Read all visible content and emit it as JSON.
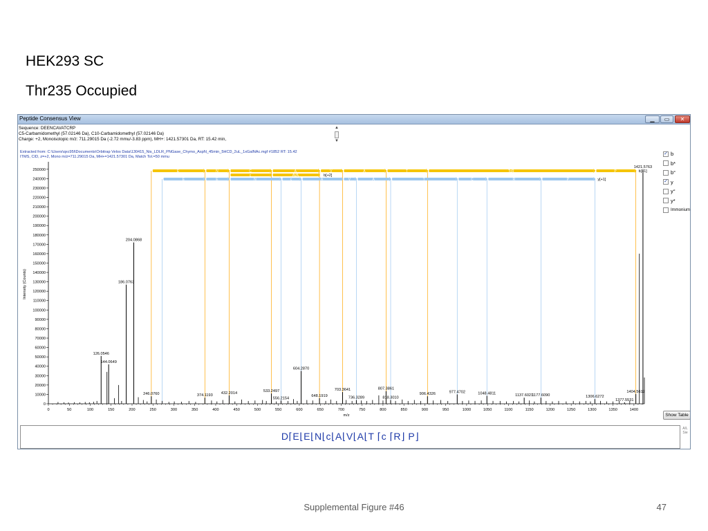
{
  "slide": {
    "title_line1": "HEK293 SC",
    "title_line2": "Thr235 Occupied",
    "footer_caption": "Supplemental Figure #46",
    "page_number": "47"
  },
  "window": {
    "title": "Peptide Consensus View",
    "min_icon": "minimize-icon",
    "max_icon": "maximize-icon",
    "close_icon": "close-icon",
    "min_glyph": "▁",
    "max_glyph": "▭",
    "close_glyph": "✕"
  },
  "info": {
    "line1": "Sequence: DEENCAVATCRP",
    "line2": "C5-Carbamidomethyl (57.02146 Da), C10-Carbamidomethyl (57.02146 Da)",
    "line3": "Charge: +2,   Monoisotopic m/z: 711.29015 Da (-2.72 mmu/-3.83 ppm),   MH+: 1421.57301 Da,   RT: 15.42 min,",
    "scroll_up": "▲",
    "scroll_down": "▼"
  },
  "spectrum_header": {
    "line1": "Extracted from: C:\\Users\\qxc95l\\Documents\\Orbitrap Velos Data\\130415_Nis_LDLR_PNGase_Chymo_AspN_45min_5HCD_2uL_1xGalNAc.mgf   #1852   RT: 15.42",
    "line2": "ITMS, CID, z=+2, Mono m/z=711.29015 Da, MH+=1421.57301 Da, Match Tol.=50 mmu"
  },
  "legend": {
    "items": [
      {
        "label": "b",
        "checked": true
      },
      {
        "label": "b*",
        "checked": false
      },
      {
        "label": "b°",
        "checked": false
      },
      {
        "label": "y",
        "checked": true
      },
      {
        "label": "y°",
        "checked": false
      },
      {
        "label": "y*",
        "checked": false
      },
      {
        "label": "Immonium",
        "checked": false
      }
    ],
    "check_glyph": "✓"
  },
  "show_table_label": "Show Table",
  "sequence_display": "D⌈E⌊E⌊N⌊c⌊A⌊V⌊A⌊T ⌈c ⌈R⌋ P⌋",
  "sequence_scroll": [
    "A/L",
    "Sie"
  ],
  "colors": {
    "b_ion": "#f5c400",
    "y_ion": "#9ac6ef",
    "matched_b": "#ffa500",
    "matched_y": "#5b9bd5",
    "peak": "#000000",
    "link": "#1e3aa8"
  },
  "chart_data": {
    "type": "bar",
    "xlabel": "m/z",
    "ylabel": "Intensity (Counts)",
    "xlim": [
      0,
      1425
    ],
    "ylim": [
      0,
      255000
    ],
    "xticks": [
      0,
      50,
      100,
      150,
      200,
      250,
      300,
      350,
      400,
      450,
      500,
      550,
      600,
      650,
      700,
      750,
      800,
      850,
      900,
      950,
      1000,
      1050,
      1100,
      1150,
      1200,
      1250,
      1300,
      1350,
      1400
    ],
    "yticks": [
      0,
      10000,
      20000,
      30000,
      40000,
      50000,
      60000,
      70000,
      80000,
      90000,
      100000,
      110000,
      120000,
      130000,
      140000,
      150000,
      160000,
      170000,
      180000,
      190000,
      200000,
      210000,
      220000,
      230000,
      240000,
      250000
    ],
    "labeled_peaks": [
      {
        "mz": 126.0546,
        "intensity": 51000,
        "label": "126.0546"
      },
      {
        "mz": 144.0649,
        "intensity": 42000,
        "label": "144.0649"
      },
      {
        "mz": 186.0763,
        "intensity": 127000,
        "label": "186.0763"
      },
      {
        "mz": 204.0868,
        "intensity": 172000,
        "label": "204.0868"
      },
      {
        "mz": 246.076,
        "intensity": 8000,
        "label": "246.0760"
      },
      {
        "mz": 374.1193,
        "intensity": 6500,
        "label": "374.1193"
      },
      {
        "mz": 432.2014,
        "intensity": 9000,
        "label": "432.2014"
      },
      {
        "mz": 533.2497,
        "intensity": 11000,
        "label": "533.2497"
      },
      {
        "mz": 556.2154,
        "intensity": 3500,
        "label": "556.2154"
      },
      {
        "mz": 604.287,
        "intensity": 35000,
        "label": "604.2870"
      },
      {
        "mz": 648.1919,
        "intensity": 6000,
        "label": "648.1919"
      },
      {
        "mz": 703.3641,
        "intensity": 12500,
        "label": "703.3641"
      },
      {
        "mz": 736.3289,
        "intensity": 4000,
        "label": "736.3289"
      },
      {
        "mz": 807.3861,
        "intensity": 13500,
        "label": "807.3861"
      },
      {
        "mz": 818.301,
        "intensity": 4000,
        "label": "818.3010"
      },
      {
        "mz": 906.4326,
        "intensity": 8000,
        "label": "906.4326"
      },
      {
        "mz": 977.4702,
        "intensity": 10000,
        "label": "977.4702"
      },
      {
        "mz": 1048.4811,
        "intensity": 8500,
        "label": "1048.4811"
      },
      {
        "mz": 1137.6021,
        "intensity": 6500,
        "label": "1137.6021"
      },
      {
        "mz": 1177.609,
        "intensity": 6500,
        "label": "1177.6090"
      },
      {
        "mz": 1306.6272,
        "intensity": 5000,
        "label": "1306.6272"
      },
      {
        "mz": 1377.5531,
        "intensity": 1500,
        "label": "1377.5531"
      },
      {
        "mz": 1404.5612,
        "intensity": 10500,
        "label": "1404.5612"
      },
      {
        "mz": 1421.5763,
        "intensity": 250000,
        "label": "1421.5763"
      }
    ],
    "unlabeled_peaks": [
      {
        "mz": 23,
        "intensity": 1800
      },
      {
        "mz": 37,
        "intensity": 1600
      },
      {
        "mz": 48,
        "intensity": 1400
      },
      {
        "mz": 62,
        "intensity": 1700
      },
      {
        "mz": 75,
        "intensity": 1500
      },
      {
        "mz": 88,
        "intensity": 1900
      },
      {
        "mz": 98,
        "intensity": 1600
      },
      {
        "mz": 108,
        "intensity": 2200
      },
      {
        "mz": 116,
        "intensity": 3000
      },
      {
        "mz": 140,
        "intensity": 34000
      },
      {
        "mz": 158,
        "intensity": 6000
      },
      {
        "mz": 168,
        "intensity": 20000
      },
      {
        "mz": 175,
        "intensity": 3000
      },
      {
        "mz": 215,
        "intensity": 7000
      },
      {
        "mz": 227,
        "intensity": 4000
      },
      {
        "mz": 236,
        "intensity": 2500
      },
      {
        "mz": 258,
        "intensity": 4500
      },
      {
        "mz": 272,
        "intensity": 3000
      },
      {
        "mz": 288,
        "intensity": 2000
      },
      {
        "mz": 301,
        "intensity": 2500
      },
      {
        "mz": 318,
        "intensity": 2200
      },
      {
        "mz": 336,
        "intensity": 3000
      },
      {
        "mz": 352,
        "intensity": 2000
      },
      {
        "mz": 390,
        "intensity": 3500
      },
      {
        "mz": 403,
        "intensity": 2500
      },
      {
        "mz": 417,
        "intensity": 4000
      },
      {
        "mz": 446,
        "intensity": 2500
      },
      {
        "mz": 462,
        "intensity": 4500
      },
      {
        "mz": 478,
        "intensity": 3000
      },
      {
        "mz": 494,
        "intensity": 3500
      },
      {
        "mz": 512,
        "intensity": 4000
      },
      {
        "mz": 521,
        "intensity": 3000
      },
      {
        "mz": 545,
        "intensity": 2500
      },
      {
        "mz": 573,
        "intensity": 3000
      },
      {
        "mz": 586,
        "intensity": 5000
      },
      {
        "mz": 595,
        "intensity": 3000
      },
      {
        "mz": 618,
        "intensity": 4000
      },
      {
        "mz": 632,
        "intensity": 3500
      },
      {
        "mz": 663,
        "intensity": 3000
      },
      {
        "mz": 675,
        "intensity": 4500
      },
      {
        "mz": 689,
        "intensity": 3000
      },
      {
        "mz": 712,
        "intensity": 4000
      },
      {
        "mz": 726,
        "intensity": 3000
      },
      {
        "mz": 748,
        "intensity": 3500
      },
      {
        "mz": 761,
        "intensity": 3000
      },
      {
        "mz": 775,
        "intensity": 4000
      },
      {
        "mz": 790,
        "intensity": 9000
      },
      {
        "mz": 800,
        "intensity": 3500
      },
      {
        "mz": 830,
        "intensity": 3000
      },
      {
        "mz": 846,
        "intensity": 4500
      },
      {
        "mz": 860,
        "intensity": 3000
      },
      {
        "mz": 875,
        "intensity": 4000
      },
      {
        "mz": 890,
        "intensity": 3000
      },
      {
        "mz": 920,
        "intensity": 3500
      },
      {
        "mz": 938,
        "intensity": 4000
      },
      {
        "mz": 955,
        "intensity": 3000
      },
      {
        "mz": 990,
        "intensity": 3000
      },
      {
        "mz": 1005,
        "intensity": 3500
      },
      {
        "mz": 1020,
        "intensity": 3000
      },
      {
        "mz": 1035,
        "intensity": 3500
      },
      {
        "mz": 1063,
        "intensity": 3000
      },
      {
        "mz": 1080,
        "intensity": 3000
      },
      {
        "mz": 1095,
        "intensity": 2500
      },
      {
        "mz": 1112,
        "intensity": 3000
      },
      {
        "mz": 1125,
        "intensity": 2500
      },
      {
        "mz": 1150,
        "intensity": 3500
      },
      {
        "mz": 1162,
        "intensity": 2500
      },
      {
        "mz": 1190,
        "intensity": 3000
      },
      {
        "mz": 1205,
        "intensity": 2500
      },
      {
        "mz": 1220,
        "intensity": 3000
      },
      {
        "mz": 1238,
        "intensity": 2500
      },
      {
        "mz": 1255,
        "intensity": 3000
      },
      {
        "mz": 1270,
        "intensity": 2500
      },
      {
        "mz": 1285,
        "intensity": 3000
      },
      {
        "mz": 1296,
        "intensity": 2500
      },
      {
        "mz": 1320,
        "intensity": 3000
      },
      {
        "mz": 1335,
        "intensity": 2500
      },
      {
        "mz": 1350,
        "intensity": 2500
      },
      {
        "mz": 1365,
        "intensity": 3000
      },
      {
        "mz": 1390,
        "intensity": 3000
      },
      {
        "mz": 1413,
        "intensity": 160000
      },
      {
        "mz": 1425,
        "intensity": 28000
      }
    ],
    "b_ions": {
      "series_label": "b[+1]",
      "matched_mz": [
        246.076,
        374.1193,
        432.2014,
        533.2497,
        648.1919,
        703.3641,
        807.3861,
        906.4326,
        1404.5612
      ],
      "segments": [
        {
          "from": 246.076,
          "to": 374.1193,
          "residue": "E"
        },
        {
          "from": 374.1193,
          "to": 432.2014,
          "residue": "N"
        },
        {
          "from": 432.2014,
          "to": 533.2497,
          "residue": "C"
        },
        {
          "from": 533.2497,
          "to": 648.1919,
          "residue": "A"
        },
        {
          "from": 648.1919,
          "to": 703.3641,
          "residue": "V"
        },
        {
          "from": 703.3641,
          "to": 807.3861,
          "residue": "A"
        },
        {
          "from": 807.3861,
          "to": 906.4326,
          "residue": "T"
        },
        {
          "from": 906.4326,
          "to": 1306.6272,
          "residue": "TcR"
        },
        {
          "from": 1306.6272,
          "to": 1404.5612,
          "residue": "P"
        }
      ]
    },
    "b2_ions": {
      "series_label": "b[+2]",
      "segments": [
        {
          "from": 432.2014,
          "to": 533.2497,
          "residue": "c"
        },
        {
          "from": 533.2497,
          "to": 648.1919,
          "residue": "AVA"
        }
      ]
    },
    "y_ions": {
      "series_label": "y[+1]",
      "matched_mz": [
        272,
        556.2154,
        604.287,
        736.3289,
        818.301,
        977.4702,
        1048.4811,
        1177.609,
        1306.6272
      ],
      "segments": [
        {
          "from": 272,
          "to": 374.1193,
          "residue": "E"
        },
        {
          "from": 374.1193,
          "to": 432.2014,
          "residue": "E"
        },
        {
          "from": 432.2014,
          "to": 556.2154,
          "residue": "N"
        },
        {
          "from": 556.2154,
          "to": 604.287,
          "residue": "c"
        },
        {
          "from": 604.287,
          "to": 703.3641,
          "residue": "A"
        },
        {
          "from": 703.3641,
          "to": 736.3289,
          "residue": "V"
        },
        {
          "from": 736.3289,
          "to": 818.301,
          "residue": "A"
        },
        {
          "from": 818.301,
          "to": 977.4702,
          "residue": "T"
        },
        {
          "from": 977.4702,
          "to": 1048.4811,
          "residue": "C"
        },
        {
          "from": 1048.4811,
          "to": 1177.609,
          "residue": "R"
        },
        {
          "from": 1177.609,
          "to": 1306.6272,
          "residue": "P"
        }
      ]
    }
  }
}
